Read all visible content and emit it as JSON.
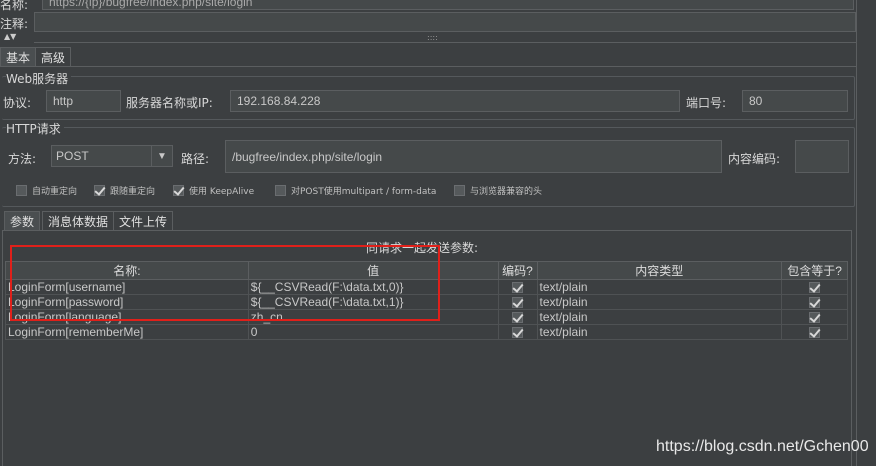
{
  "top": {
    "name_label": "名称:",
    "name_value": "https://{ip}/bugfree/index.php/site/login",
    "comment_label": "注释:",
    "grip": "::::"
  },
  "tabs": [
    {
      "label": "基本",
      "active": true
    },
    {
      "label": "高级",
      "active": false
    }
  ],
  "web_server": {
    "title": "Web服务器",
    "protocol_label": "协议:",
    "protocol_value": "http",
    "server_label": "服务器名称或IP:",
    "server_value": "192.168.84.228",
    "port_label": "端口号:",
    "port_value": "80"
  },
  "http_request": {
    "title": "HTTP请求",
    "method_label": "方法:",
    "method_value": "POST",
    "path_label": "路径:",
    "path_value": "/bugfree/index.php/site/login",
    "encoding_label": "内容编码:",
    "encoding_value": ""
  },
  "options": [
    {
      "label": "自动重定向",
      "checked": false
    },
    {
      "label": "跟随重定向",
      "checked": true
    },
    {
      "label": "使用 KeepAlive",
      "checked": true
    },
    {
      "label": "对POST使用multipart / form-data",
      "checked": false
    },
    {
      "label": "与浏览器兼容的头",
      "checked": false
    }
  ],
  "sub_tabs": [
    {
      "label": "参数",
      "active": true
    },
    {
      "label": "消息体数据",
      "active": false
    },
    {
      "label": "文件上传",
      "active": false
    }
  ],
  "params": {
    "caption": "同请求一起发送参数:",
    "columns": [
      "名称:",
      "值",
      "编码?",
      "内容类型",
      "包含等于?"
    ],
    "rows": [
      {
        "name": "LoginForm[username]",
        "value": "${__CSVRead(F:\\data.txt,0)}",
        "encode": true,
        "content_type": "text/plain",
        "include_equals": true
      },
      {
        "name": "LoginForm[password]",
        "value": "${__CSVRead(F:\\data.txt,1)}",
        "encode": true,
        "content_type": "text/plain",
        "include_equals": true
      },
      {
        "name": "LoginForm[language]",
        "value": "zh_cn",
        "encode": true,
        "content_type": "text/plain",
        "include_equals": true
      },
      {
        "name": "LoginForm[rememberMe]",
        "value": "0",
        "encode": true,
        "content_type": "text/plain",
        "include_equals": true
      }
    ]
  },
  "watermark": "https://blog.csdn.net/Gchen00",
  "colors": {
    "highlight": "#e0201a",
    "background": "#3c3f41"
  }
}
